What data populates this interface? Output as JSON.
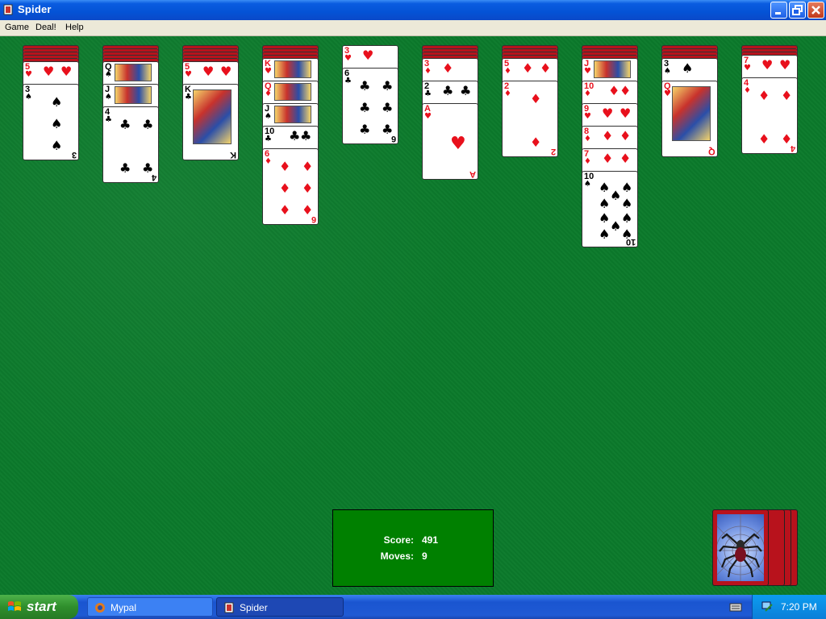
{
  "window": {
    "title": "Spider"
  },
  "menu": [
    {
      "label": "Game"
    },
    {
      "label": "Deal!"
    },
    {
      "label": "Help"
    }
  ],
  "status": {
    "score_label": "Score:",
    "score_value": "491",
    "moves_label": "Moves:",
    "moves_value": "9"
  },
  "tableau": [
    {
      "face_down": 5,
      "cards": [
        {
          "rank": "5",
          "suit": "♥",
          "color": "red"
        },
        {
          "rank": "3",
          "suit": "♠",
          "color": "black"
        }
      ]
    },
    {
      "face_down": 5,
      "cards": [
        {
          "rank": "Q",
          "suit": "♠",
          "color": "black"
        },
        {
          "rank": "J",
          "suit": "♠",
          "color": "black"
        },
        {
          "rank": "4",
          "suit": "♣",
          "color": "black"
        }
      ]
    },
    {
      "face_down": 5,
      "cards": [
        {
          "rank": "5",
          "suit": "♥",
          "color": "red"
        },
        {
          "rank": "K",
          "suit": "♣",
          "color": "black"
        }
      ]
    },
    {
      "face_down": 4,
      "cards": [
        {
          "rank": "K",
          "suit": "♥",
          "color": "red"
        },
        {
          "rank": "Q",
          "suit": "♦",
          "color": "red"
        },
        {
          "rank": "J",
          "suit": "♠",
          "color": "black"
        },
        {
          "rank": "10",
          "suit": "♣",
          "color": "black"
        },
        {
          "rank": "6",
          "suit": "♦",
          "color": "red"
        }
      ]
    },
    {
      "face_down": 0,
      "cards": [
        {
          "rank": "3",
          "suit": "♥",
          "color": "red"
        },
        {
          "rank": "6",
          "suit": "♣",
          "color": "black"
        }
      ]
    },
    {
      "face_down": 4,
      "cards": [
        {
          "rank": "3",
          "suit": "♦",
          "color": "red"
        },
        {
          "rank": "2",
          "suit": "♣",
          "color": "black"
        },
        {
          "rank": "A",
          "suit": "♥",
          "color": "red"
        }
      ]
    },
    {
      "face_down": 4,
      "cards": [
        {
          "rank": "5",
          "suit": "♦",
          "color": "red"
        },
        {
          "rank": "2",
          "suit": "♦",
          "color": "red"
        }
      ]
    },
    {
      "face_down": 4,
      "cards": [
        {
          "rank": "J",
          "suit": "♥",
          "color": "red"
        },
        {
          "rank": "10",
          "suit": "♦",
          "color": "red"
        },
        {
          "rank": "9",
          "suit": "♥",
          "color": "red"
        },
        {
          "rank": "8",
          "suit": "♦",
          "color": "red"
        },
        {
          "rank": "7",
          "suit": "♦",
          "color": "red"
        },
        {
          "rank": "10",
          "suit": "♠",
          "color": "black"
        }
      ]
    },
    {
      "face_down": 4,
      "cards": [
        {
          "rank": "3",
          "suit": "♠",
          "color": "black"
        },
        {
          "rank": "Q",
          "suit": "♥",
          "color": "red"
        }
      ]
    },
    {
      "face_down": 3,
      "cards": [
        {
          "rank": "7",
          "suit": "♥",
          "color": "red"
        },
        {
          "rank": "4",
          "suit": "♦",
          "color": "red"
        }
      ]
    }
  ],
  "stock": {
    "piles": 4
  },
  "taskbar": {
    "start_label": "start",
    "tasks": [
      {
        "label": "Mypal"
      },
      {
        "label": "Spider"
      }
    ],
    "clock": "7:20 PM"
  },
  "colors": {
    "felt": "#0b7a2b",
    "score_box": "#008000",
    "card_red": "#e8101c",
    "card_back": "#b8121c"
  }
}
